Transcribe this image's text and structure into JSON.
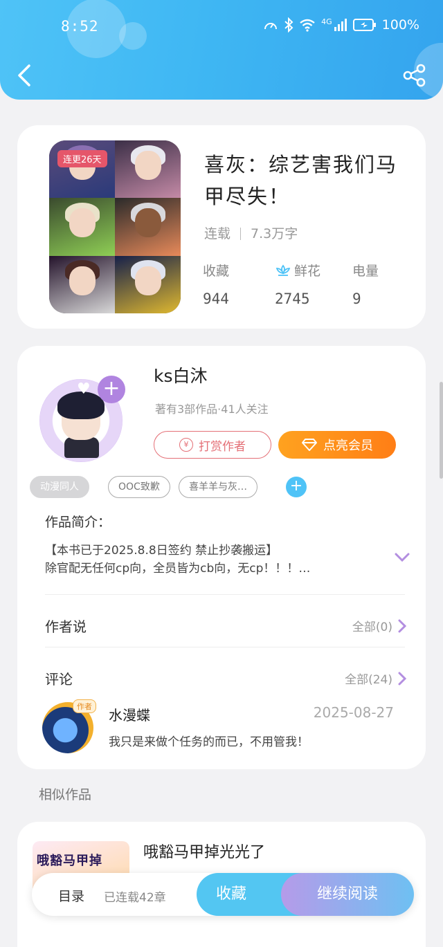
{
  "status_bar": {
    "time": "8:52",
    "network": "4G",
    "battery": "100%"
  },
  "header": {
    "back_icon": "chevron-left-icon",
    "share_icon": "share-icon",
    "accent": "#3fb7f3"
  },
  "book": {
    "badge": "连更26天",
    "title": "喜灰：综艺害我们马甲尽失！",
    "status": "连载",
    "word_count": "7.3万字",
    "stats": [
      {
        "label": "收藏",
        "value": "944"
      },
      {
        "label": "鲜花",
        "value": "2745",
        "icon": "flower-icon"
      },
      {
        "label": "电量",
        "value": "9"
      }
    ]
  },
  "author": {
    "name": "ks白沐",
    "summary": "著有3部作品·41人关注",
    "tip_label": "打赏作者",
    "vip_label": "点亮会员",
    "tags": [
      "动漫同人",
      "OOC致歉",
      "喜羊羊与灰…"
    ]
  },
  "intro": {
    "title": "作品简介：",
    "lines": [
      "【本书已于2025.8.8日签约 禁止抄袭搬运】",
      "除官配无任何cp向，全员皆为cb向，无cp！！！…"
    ]
  },
  "author_notes": {
    "title": "作者说",
    "more": "全部(0)"
  },
  "comments": {
    "title": "评论",
    "more": "全部(24)",
    "items": [
      {
        "badge": "作者",
        "user": "水漫蝶",
        "date": "2025-08-27",
        "text": "我只是来做个任务的而已，不用管我！"
      }
    ]
  },
  "similar": {
    "title": "相似作品",
    "items": [
      {
        "cover_text": "哦豁马甲掉",
        "title": "哦豁马甲掉光光了"
      }
    ]
  },
  "bottom_bar": {
    "toc_label": "目录",
    "chapters": "已连载42章",
    "fav_label": "收藏",
    "read_label": "继续阅读"
  }
}
